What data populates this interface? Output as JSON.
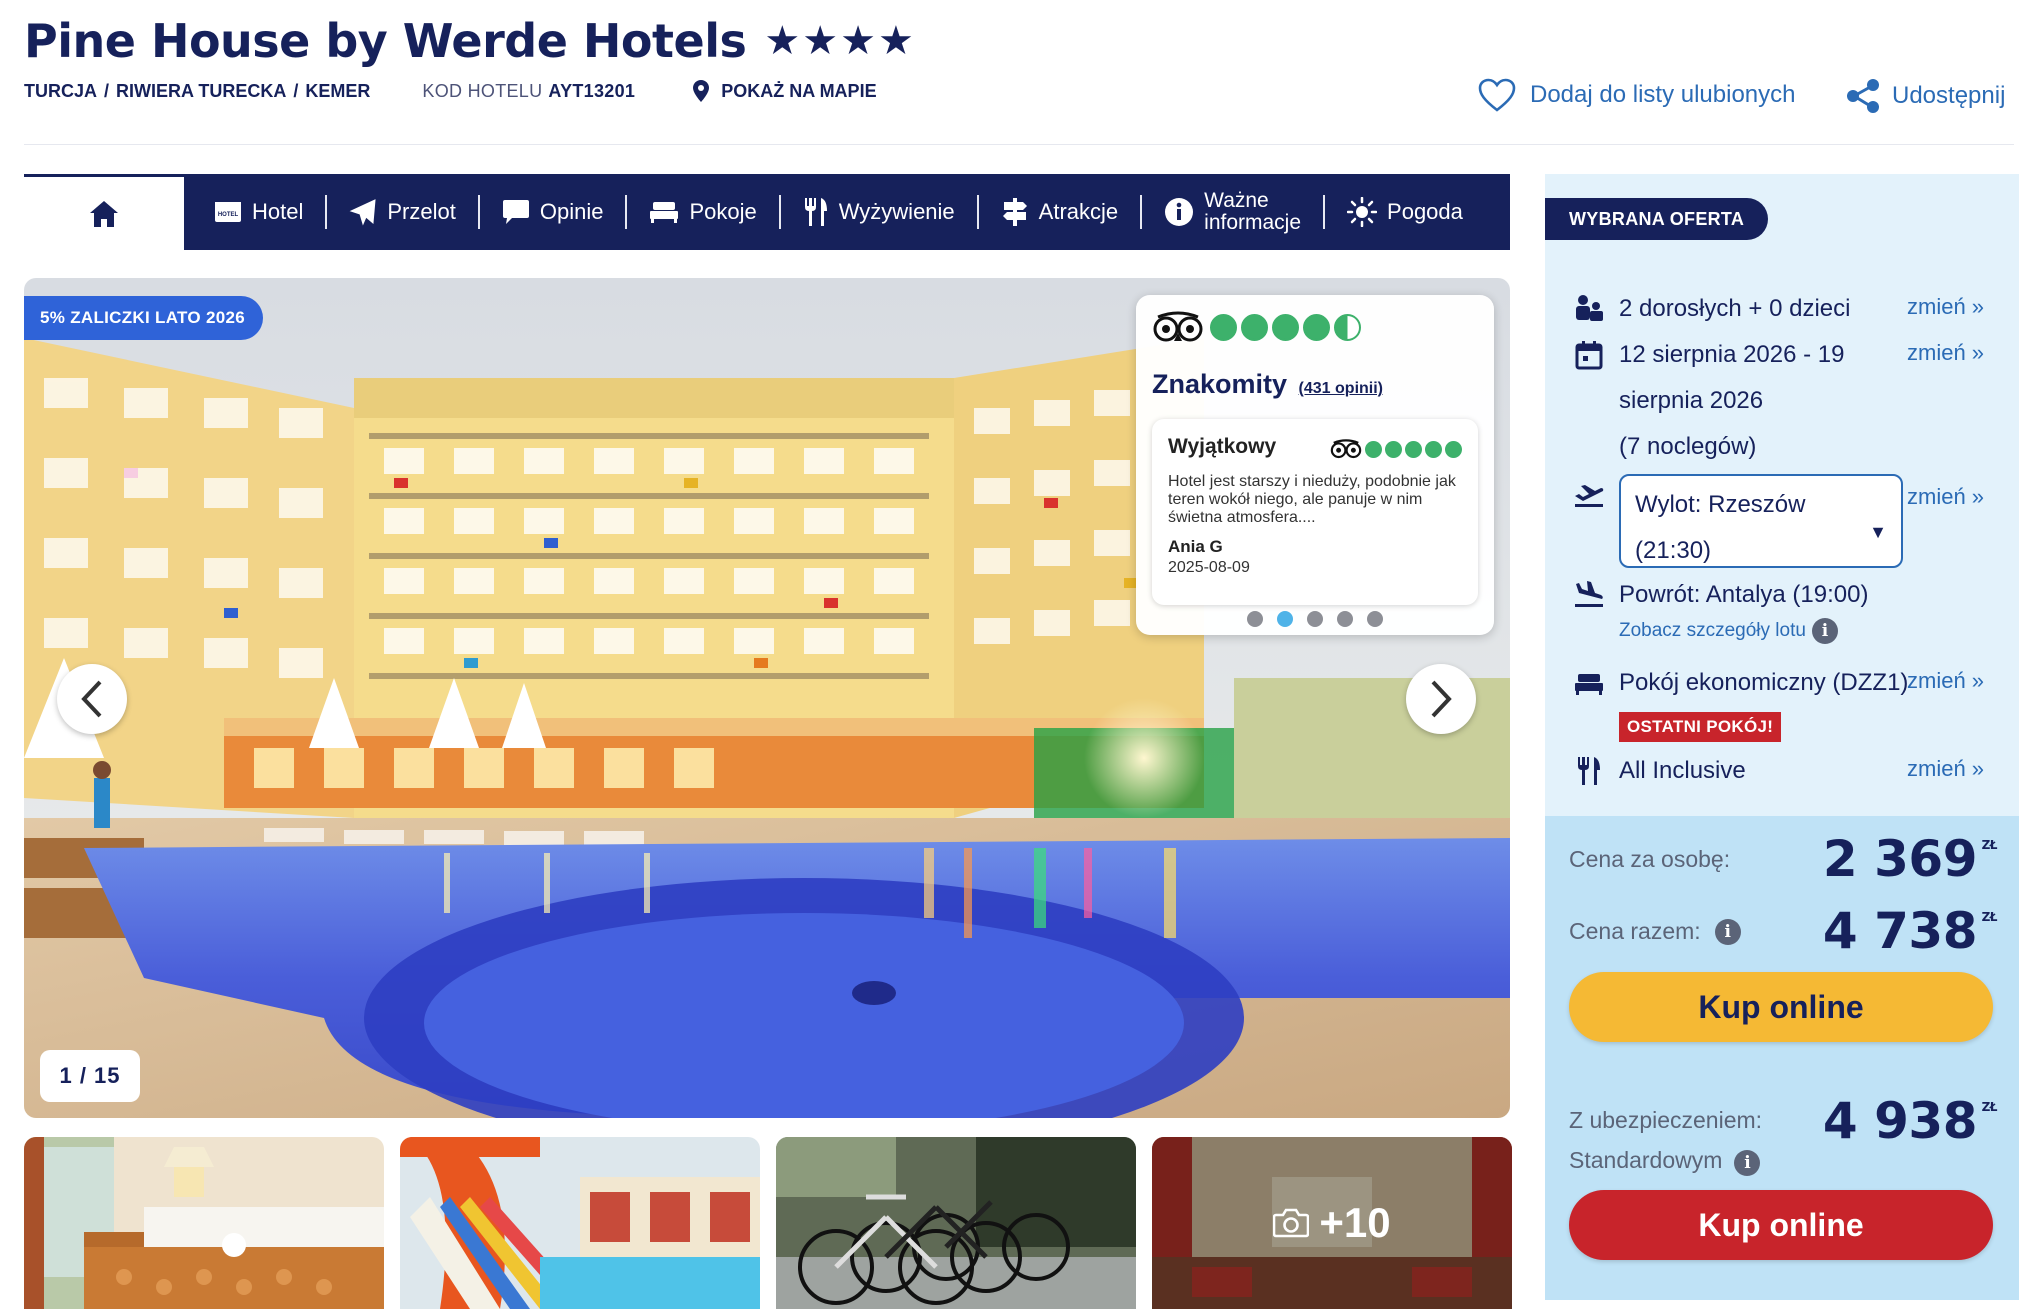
{
  "hotel": {
    "name": "Pine House by Werde Hotels",
    "stars": "★★★★",
    "breadcrumb": [
      "TURCJA",
      "RIWIERA TURECKA",
      "KEMER"
    ],
    "code_label": "KOD HOTELU",
    "code_value": "AYT13201",
    "map_link": "POKAŻ NA MAPIE",
    "favorite": "Dodaj do listy ulubionych",
    "share": "Udostępnij"
  },
  "nav": {
    "items": [
      {
        "label": "Hotel",
        "icon": "hotel-icon"
      },
      {
        "label": "Przelot",
        "icon": "plane-icon"
      },
      {
        "label": "Opinie",
        "icon": "chat-bubble-icon"
      },
      {
        "label": "Pokoje",
        "icon": "bed-icon"
      },
      {
        "label": "Wyżywienie",
        "icon": "cutlery-icon"
      },
      {
        "label": "Atrakcje",
        "icon": "signpost-icon"
      },
      {
        "label_line1": "Ważne",
        "label_line2": "informacje",
        "icon": "info-icon"
      },
      {
        "label": "Pogoda",
        "icon": "sun-icon"
      }
    ]
  },
  "gallery": {
    "promo": "5% ZALICZKI LATO 2026",
    "counter": "1 / 15",
    "more_photos": "+10"
  },
  "tripadvisor": {
    "rating_label": "Znakomity",
    "reviews_link": "(431 opinii)",
    "rating_value": 4.5,
    "review": {
      "title": "Wyjątkowy",
      "text": "Hotel jest starszy i nieduży, podobnie jak teren wokół niego, ale panuje w nim świetna atmosfera....",
      "author": "Ania G",
      "date": "2025-08-09"
    },
    "pager_count": 5,
    "pager_active": 1
  },
  "offer": {
    "badge": "WYBRANA OFERTA",
    "change_label": "zmień »",
    "travellers": "2 dorosłych + 0 dzieci",
    "dates_l1": "12 sierpnia 2026 - 19",
    "dates_l2": "sierpnia 2026",
    "dates_l3": "(7 noclegów)",
    "departure_l1": "Wylot: Rzeszów",
    "departure_l2": "(21:30)",
    "return": "Powrót: Antalya (19:00)",
    "flight_details": "Zobacz szczegóły lotu",
    "room": "Pokój ekonomiczny (DZZ1)",
    "last_room": "OSTATNI POKÓJ!",
    "board": "All Inclusive",
    "price_per_person_label": "Cena za osobę:",
    "price_per_person": "2 369",
    "price_total_label": "Cena razem:",
    "price_total": "4 738",
    "currency": "ZŁ",
    "buy_label": "Kup online",
    "insurance_label_l1": "Z ubezpieczeniem:",
    "insurance_label_l2": "Standardowym",
    "price_insurance": "4 938"
  },
  "colors": {
    "navy": "#16215b",
    "link": "#2b6bb5",
    "promo_blue": "#2f63d8",
    "yellow_button": "#f5b934",
    "red_button": "#c8242b",
    "panel_bg": "#e3f2fb",
    "price_bg": "#bfe2f6",
    "ta_green": "#3db16b"
  }
}
